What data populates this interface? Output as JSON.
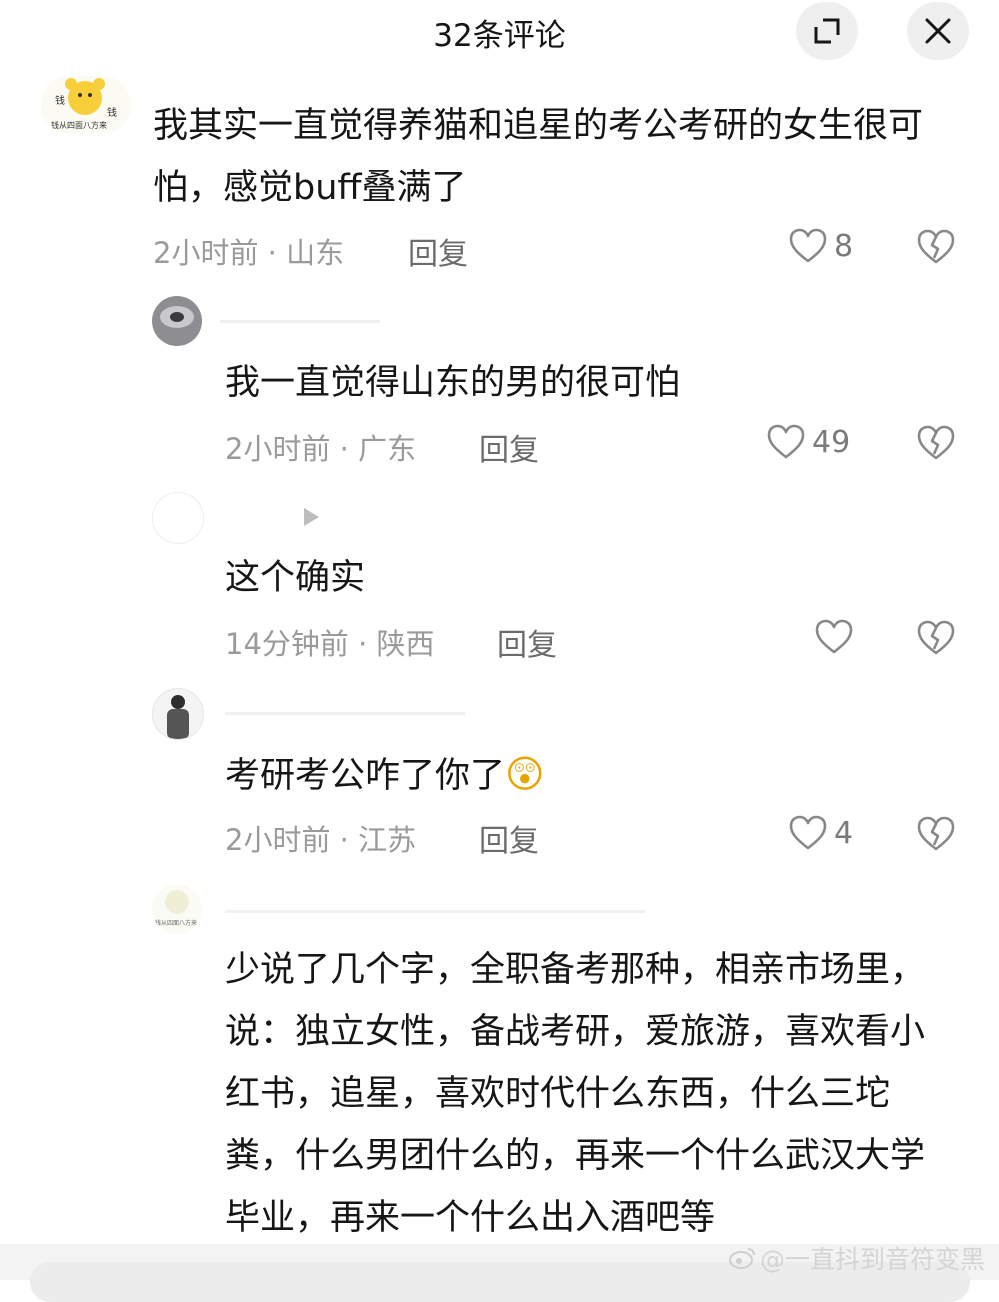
{
  "header": {
    "title": "32条评论"
  },
  "comments": [
    {
      "text": "我其实一直觉得养猫和追星的考公考研的女生很可怕，感觉buff叠满了",
      "meta": "2小时前 · 山东",
      "reply": "回复",
      "likes": "8",
      "avatar_text": "钱从四面八方来",
      "avatar_text_left": "钱",
      "avatar_text_right": "钱"
    },
    {
      "text": "我一直觉得山东的男的很可怕",
      "meta": "2小时前 · 广东",
      "reply": "回复",
      "likes": "49"
    },
    {
      "text": "这个确实",
      "meta": "14分钟前 · 陕西",
      "reply": "回复",
      "likes": ""
    },
    {
      "text": "考研考公咋了你了",
      "emoji": "😲",
      "meta": "2小时前 · 江苏",
      "reply": "回复",
      "likes": "4"
    },
    {
      "text": "少说了几个字，全职备考那种，相亲市场里，说：独立女性，备战考研，爱旅游，喜欢看小红书，追星，喜欢时代什么东西，什么三坨粪，什么男团什么的，再来一个什么武汉大学毕业，再来一个什么出入酒吧等",
      "avatar_text": "钱从四面八方来"
    }
  ],
  "watermark": "@一直抖到音符变黑",
  "icons": {
    "expand": "expand-icon",
    "close": "close-icon",
    "like": "heart-icon",
    "dislike": "broken-heart-icon",
    "watermark": "weibo-icon",
    "play": "play-icon"
  }
}
